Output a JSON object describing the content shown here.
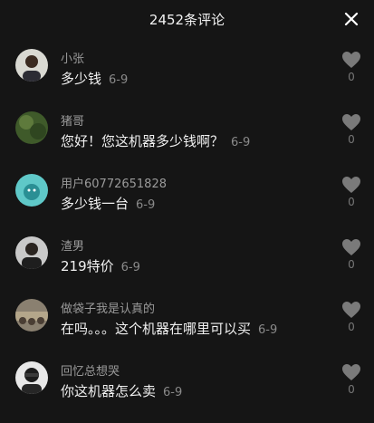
{
  "header": {
    "title": "2452条评论"
  },
  "comments": [
    {
      "user": "小张",
      "text": "多少钱",
      "date": "6-9",
      "likes": "0"
    },
    {
      "user": "猪哥",
      "text": "您好！您这机器多少钱啊？",
      "date": "6-9",
      "likes": "0"
    },
    {
      "user": "用户60772651828",
      "text": "多少钱一台",
      "date": "6-9",
      "likes": "0"
    },
    {
      "user": "渣男",
      "text": "219特价",
      "date": "6-9",
      "likes": "0"
    },
    {
      "user": "做袋子我是认真的",
      "text": "在吗。。。这个机器在哪里可以买",
      "date": "6-9",
      "likes": "0"
    },
    {
      "user": "回忆总想哭",
      "text": "你这机器怎么卖",
      "date": "6-9",
      "likes": "0"
    }
  ],
  "icons": {
    "close": "close-icon",
    "like": "heart-icon"
  },
  "colors": {
    "background": "#151515",
    "username": "#9a9a9a",
    "date": "#8a8a8a"
  }
}
